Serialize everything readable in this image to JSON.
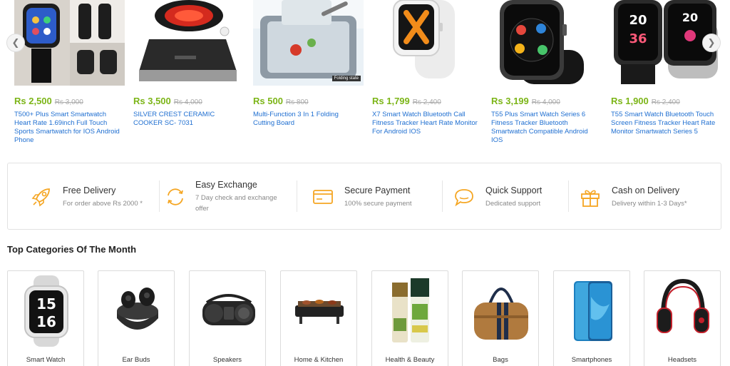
{
  "products": [
    {
      "price": "Rs 2,500",
      "old_price": "Rs 3,000",
      "name": "T500+ Plus Smart Smartwatch Heart Rate 1.69inch Full Touch Sports Smartwatch for IOS Android Phone",
      "image": "smartwatch-collage"
    },
    {
      "price": "Rs 3,500",
      "old_price": "Rs 4,000",
      "name": "SILVER CREST CERAMIC COOKER SC- 7031",
      "image": "ceramic-cooker"
    },
    {
      "price": "Rs 500",
      "old_price": "Rs 800",
      "name": "Multi-Function 3 In 1 Folding Cutting Board",
      "image": "folding-cutting-board",
      "image_caption": "Folding state"
    },
    {
      "price": "Rs 1,799",
      "old_price": "Rs 2,400",
      "name": "X7 Smart Watch Bluetooth Call Fitness Tracker Heart Rate Monitor For Android IOS",
      "image": "white-smartwatch"
    },
    {
      "price": "Rs 3,199",
      "old_price": "Rs 4,000",
      "name": "T55 Plus Smart Watch Series 6 Fitness Tracker Bluetooth Smartwatch Compatible Android IOS",
      "image": "black-smartwatch"
    },
    {
      "price": "Rs 1,900",
      "old_price": "Rs 2,400",
      "name": "T55 Smart Watch Bluetooth Touch Screen Fitness Tracker Heart Rate Monitor Smartwatch Series 5",
      "image": "dual-smartwatch"
    }
  ],
  "carousel": {
    "prev_icon": "chevron-left-icon",
    "next_icon": "chevron-right-icon"
  },
  "features": [
    {
      "title": "Free Delivery",
      "subtitle": "For order above Rs 2000 *",
      "icon": "rocket-icon"
    },
    {
      "title": "Easy Exchange",
      "subtitle": "7 Day check and exchange offer",
      "icon": "exchange-icon"
    },
    {
      "title": "Secure Payment",
      "subtitle": "100% secure payment",
      "icon": "card-icon"
    },
    {
      "title": "Quick Support",
      "subtitle": "Dedicated support",
      "icon": "chat-icon"
    },
    {
      "title": "Cash on Delivery",
      "subtitle": "Delivery within 1-3 Days*",
      "icon": "gift-icon"
    }
  ],
  "categories_title": "Top Categories Of The Month",
  "categories": [
    {
      "label": "Smart Watch"
    },
    {
      "label": "Ear Buds"
    },
    {
      "label": "Speakers"
    },
    {
      "label": "Home & Kitchen"
    },
    {
      "label": "Health & Beauty"
    },
    {
      "label": "Bags"
    },
    {
      "label": "Smartphones"
    },
    {
      "label": "Headsets"
    }
  ],
  "colors": {
    "price": "#7cb518",
    "link": "#1f6fd1",
    "feature_icon": "#f5a623"
  }
}
